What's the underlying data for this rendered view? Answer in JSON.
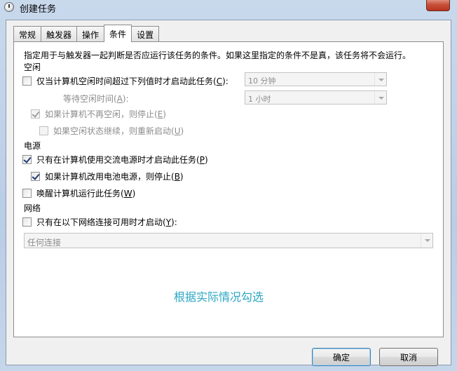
{
  "window": {
    "title": "创建任务"
  },
  "tabs": [
    "常规",
    "触发器",
    "操作",
    "条件",
    "设置"
  ],
  "active_tab": "条件",
  "description": "指定用于与触发器一起判断是否应运行该任务的条件。如果这里指定的条件不是真，该任务将不会运行。",
  "idle": {
    "section_label": "空闲",
    "start_if_idle": {
      "text": "仅当计算机空闲时间超过下列值时才启动此任务(",
      "key": "C",
      "suffix": "):",
      "checked": false
    },
    "idle_duration": "10 分钟",
    "wait_label": {
      "text": "等待空闲时间(",
      "key": "A",
      "suffix": "):"
    },
    "wait_duration": "1 小时",
    "stop_if_not_idle": {
      "text": "如果计算机不再空闲，则停止(",
      "key": "E",
      "suffix": ")",
      "checked": true
    },
    "restart_if_idle": {
      "text": "如果空闲状态继续，则重新启动(",
      "key": "U",
      "suffix": ")",
      "checked": false
    }
  },
  "power": {
    "section_label": "电源",
    "ac_only": {
      "text": "只有在计算机使用交流电源时才启动此任务(",
      "key": "P",
      "suffix": ")",
      "checked": true
    },
    "stop_on_battery": {
      "text": "如果计算机改用电池电源，则停止(",
      "key": "B",
      "suffix": ")",
      "checked": true
    },
    "wake": {
      "text": "唤醒计算机运行此任务(",
      "key": "W",
      "suffix": ")",
      "checked": false
    }
  },
  "network": {
    "section_label": "网络",
    "only_if_network": {
      "text": "只有在以下网络连接可用时才启动(",
      "key": "Y",
      "suffix": "):",
      "checked": false
    },
    "connection": "任何连接"
  },
  "note": "根据实际情况勾选",
  "buttons": {
    "ok": "确定",
    "cancel": "取消"
  }
}
